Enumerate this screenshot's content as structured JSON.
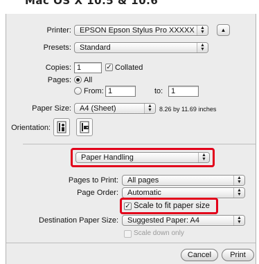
{
  "heading": "Mac OS X 10.5 & 10.6",
  "printer": {
    "label": "Printer:",
    "value": "EPSON Epson Stylus Pro XXXXX"
  },
  "presets": {
    "label": "Presets:",
    "value": "Standard"
  },
  "copies": {
    "label": "Copies:",
    "value": "1",
    "collated_label": "Collated",
    "collated_checked": true
  },
  "pages": {
    "label": "Pages:",
    "all_label": "All",
    "from_label": "From:",
    "from_value": "1",
    "to_label": "to:",
    "to_value": "1"
  },
  "paper_size": {
    "label": "Paper Size:",
    "value": "A4 (Sheet)",
    "dimensions": "8.26 by 11.69 inches"
  },
  "orientation": {
    "label": "Orientation:"
  },
  "section_popup": {
    "value": "Paper Handling"
  },
  "pages_to_print": {
    "label": "Pages to Print:",
    "value": "All pages"
  },
  "page_order": {
    "label": "Page Order:",
    "value": "Automatic"
  },
  "scale_to_fit": {
    "label": "Scale to fit paper size",
    "checked": true
  },
  "destination_paper_size": {
    "label": "Destination Paper Size:",
    "value": "Suggested Paper: A4"
  },
  "scale_down_only": {
    "label": "Scale down only",
    "checked": false
  },
  "buttons": {
    "cancel": "Cancel",
    "print": "Print"
  },
  "colors": {
    "highlight": "#e2001a",
    "dialog_bg": "#ececec"
  },
  "icons": [
    "up-arrow-icon",
    "portrait-orientation-icon",
    "landscape-orientation-icon",
    "popup-arrows-icon",
    "checkmark-icon"
  ]
}
